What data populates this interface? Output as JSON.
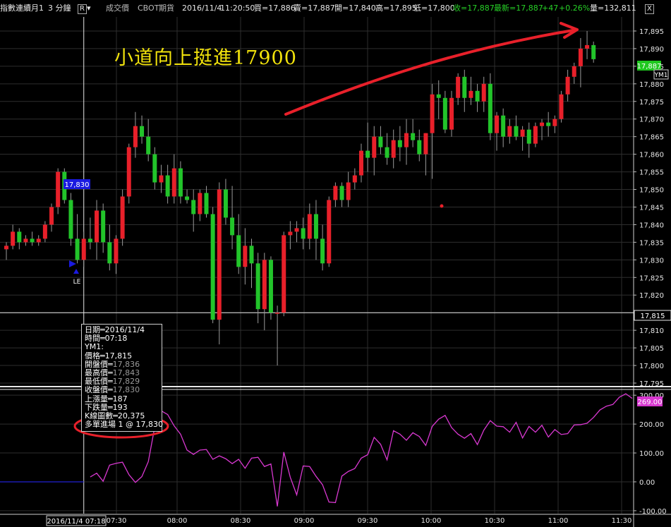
{
  "header": {
    "symbol": "指數連續月1",
    "interval": "3 分鐘",
    "r_button": "R",
    "price_type": "成交價",
    "exchange": "CBOT",
    "instrument": "期貨",
    "date": "2016/11/4",
    "time": "11:20:50",
    "bid": "買=17,886",
    "ask": "賣=17,887",
    "open": "開=17,840",
    "high": "高=17,895",
    "low": "低=17,800",
    "close": "收=17,887",
    "last": "最新=17,887",
    "change": "+47",
    "change_pct": "+0.26%",
    "volume": "量=132,811",
    "close_button": "X"
  },
  "annotation": {
    "title": "小道向上挺進17900",
    "entry_marker": "LE",
    "entry_price_tag": "17,830"
  },
  "info_box": {
    "date": "日期═2016/11/4",
    "time": "時間═07:18",
    "symbol": "YM1:",
    "price": "價格═17,815",
    "open_label": "開盤價═",
    "open_value": "17,836",
    "high_label": "最高價═",
    "high_value": "17,843",
    "low_label": "最低價═",
    "low_value": "17,829",
    "close_label": "收盤價═",
    "close_value": "17,830",
    "up_vol": "上漲量═187",
    "down_vol": "下跌量═193",
    "indicator": "K線圖數═20,375",
    "entry": "多單進場 1 @ 17,830"
  },
  "last_price_tag": "17,887",
  "symbol_tag": "YM1",
  "cursor_price_tag": "17,815",
  "indicator_tag": "269.00",
  "cursor_time_tag": "2016/11/4 07:18",
  "colors": {
    "up": "#e8202a",
    "down": "#22c42a",
    "indicator": "#d838d0",
    "background": "#000000",
    "grid": "#2e2e2e",
    "annotation_text": "#f2e30c",
    "arrow": "#e8202a",
    "last_price_tag": "#1fc81f",
    "indicator_tag": "#d838d0",
    "entry_tag": "#1a1ae0"
  },
  "chart_data": [
    {
      "type": "candlestick",
      "title": "",
      "x_ticks": [
        "07:30",
        "08:00",
        "08:30",
        "09:00",
        "09:30",
        "10:00",
        "10:30",
        "11:00",
        "11:30"
      ],
      "y_ticks": [
        17795,
        17800,
        17805,
        17810,
        17815,
        17820,
        17825,
        17830,
        17835,
        17840,
        17845,
        17850,
        17855,
        17860,
        17865,
        17870,
        17875,
        17880,
        17885,
        17890,
        17895
      ],
      "ylim": [
        17794,
        17899
      ],
      "grid": true,
      "candles": [
        {
          "o": 17833,
          "h": 17835,
          "l": 17830,
          "c": 17834
        },
        {
          "o": 17834,
          "h": 17840,
          "l": 17833,
          "c": 17838
        },
        {
          "o": 17838,
          "h": 17839,
          "l": 17833,
          "c": 17835
        },
        {
          "o": 17835,
          "h": 17837,
          "l": 17834,
          "c": 17836
        },
        {
          "o": 17836,
          "h": 17838,
          "l": 17834,
          "c": 17835
        },
        {
          "o": 17835,
          "h": 17837,
          "l": 17834,
          "c": 17836
        },
        {
          "o": 17836,
          "h": 17841,
          "l": 17835,
          "c": 17840
        },
        {
          "o": 17840,
          "h": 17846,
          "l": 17838,
          "c": 17845
        },
        {
          "o": 17845,
          "h": 17856,
          "l": 17843,
          "c": 17855
        },
        {
          "o": 17855,
          "h": 17856,
          "l": 17846,
          "c": 17847
        },
        {
          "o": 17847,
          "h": 17849,
          "l": 17834,
          "c": 17836
        },
        {
          "o": 17836,
          "h": 17843,
          "l": 17829,
          "c": 17830
        },
        {
          "o": 17830,
          "h": 17838,
          "l": 17828,
          "c": 17836
        },
        {
          "o": 17836,
          "h": 17842,
          "l": 17833,
          "c": 17835
        },
        {
          "o": 17835,
          "h": 17847,
          "l": 17830,
          "c": 17844
        },
        {
          "o": 17844,
          "h": 17846,
          "l": 17832,
          "c": 17835
        },
        {
          "o": 17835,
          "h": 17840,
          "l": 17827,
          "c": 17829
        },
        {
          "o": 17829,
          "h": 17837,
          "l": 17826,
          "c": 17836
        },
        {
          "o": 17836,
          "h": 17850,
          "l": 17834,
          "c": 17848
        },
        {
          "o": 17848,
          "h": 17863,
          "l": 17846,
          "c": 17862
        },
        {
          "o": 17862,
          "h": 17872,
          "l": 17859,
          "c": 17868
        },
        {
          "o": 17868,
          "h": 17871,
          "l": 17863,
          "c": 17865
        },
        {
          "o": 17865,
          "h": 17870,
          "l": 17858,
          "c": 17860
        },
        {
          "o": 17860,
          "h": 17862,
          "l": 17850,
          "c": 17852
        },
        {
          "o": 17852,
          "h": 17857,
          "l": 17849,
          "c": 17854
        },
        {
          "o": 17854,
          "h": 17857,
          "l": 17846,
          "c": 17848
        },
        {
          "o": 17848,
          "h": 17860,
          "l": 17846,
          "c": 17856
        },
        {
          "o": 17856,
          "h": 17858,
          "l": 17846,
          "c": 17848
        },
        {
          "o": 17848,
          "h": 17850,
          "l": 17846,
          "c": 17847
        },
        {
          "o": 17847,
          "h": 17850,
          "l": 17838,
          "c": 17843
        },
        {
          "o": 17843,
          "h": 17850,
          "l": 17841,
          "c": 17849
        },
        {
          "o": 17849,
          "h": 17851,
          "l": 17842,
          "c": 17843
        },
        {
          "o": 17843,
          "h": 17845,
          "l": 17812,
          "c": 17813
        },
        {
          "o": 17813,
          "h": 17852,
          "l": 17806,
          "c": 17850
        },
        {
          "o": 17850,
          "h": 17853,
          "l": 17840,
          "c": 17842
        },
        {
          "o": 17842,
          "h": 17851,
          "l": 17833,
          "c": 17837
        },
        {
          "o": 17837,
          "h": 17843,
          "l": 17826,
          "c": 17828
        },
        {
          "o": 17828,
          "h": 17839,
          "l": 17823,
          "c": 17834
        },
        {
          "o": 17834,
          "h": 17836,
          "l": 17822,
          "c": 17829
        },
        {
          "o": 17829,
          "h": 17832,
          "l": 17812,
          "c": 17816
        },
        {
          "o": 17816,
          "h": 17832,
          "l": 17810,
          "c": 17830
        },
        {
          "o": 17830,
          "h": 17831,
          "l": 17813,
          "c": 17815
        },
        {
          "o": 17815,
          "h": 17817,
          "l": 17800,
          "c": 17815
        },
        {
          "o": 17815,
          "h": 17838,
          "l": 17814,
          "c": 17837
        },
        {
          "o": 17837,
          "h": 17841,
          "l": 17833,
          "c": 17838
        },
        {
          "o": 17838,
          "h": 17841,
          "l": 17835,
          "c": 17839
        },
        {
          "o": 17839,
          "h": 17842,
          "l": 17833,
          "c": 17836
        },
        {
          "o": 17836,
          "h": 17846,
          "l": 17833,
          "c": 17843
        },
        {
          "o": 17843,
          "h": 17847,
          "l": 17830,
          "c": 17836
        },
        {
          "o": 17836,
          "h": 17840,
          "l": 17827,
          "c": 17829
        },
        {
          "o": 17829,
          "h": 17848,
          "l": 17828,
          "c": 17847
        },
        {
          "o": 17847,
          "h": 17852,
          "l": 17845,
          "c": 17851
        },
        {
          "o": 17851,
          "h": 17852,
          "l": 17845,
          "c": 17847
        },
        {
          "o": 17847,
          "h": 17855,
          "l": 17845,
          "c": 17852
        },
        {
          "o": 17852,
          "h": 17856,
          "l": 17850,
          "c": 17854
        },
        {
          "o": 17854,
          "h": 17863,
          "l": 17852,
          "c": 17861
        },
        {
          "o": 17861,
          "h": 17869,
          "l": 17855,
          "c": 17859
        },
        {
          "o": 17859,
          "h": 17868,
          "l": 17854,
          "c": 17865
        },
        {
          "o": 17865,
          "h": 17868,
          "l": 17860,
          "c": 17862
        },
        {
          "o": 17862,
          "h": 17866,
          "l": 17857,
          "c": 17859
        },
        {
          "o": 17859,
          "h": 17867,
          "l": 17856,
          "c": 17864
        },
        {
          "o": 17864,
          "h": 17868,
          "l": 17858,
          "c": 17862
        },
        {
          "o": 17862,
          "h": 17870,
          "l": 17857,
          "c": 17866
        },
        {
          "o": 17866,
          "h": 17870,
          "l": 17862,
          "c": 17864
        },
        {
          "o": 17864,
          "h": 17867,
          "l": 17858,
          "c": 17860
        },
        {
          "o": 17860,
          "h": 17866,
          "l": 17854,
          "c": 17866
        },
        {
          "o": 17866,
          "h": 17880,
          "l": 17853,
          "c": 17877
        },
        {
          "o": 17877,
          "h": 17881,
          "l": 17870,
          "c": 17876
        },
        {
          "o": 17876,
          "h": 17878,
          "l": 17866,
          "c": 17867
        },
        {
          "o": 17867,
          "h": 17878,
          "l": 17865,
          "c": 17876
        },
        {
          "o": 17876,
          "h": 17883,
          "l": 17874,
          "c": 17882
        },
        {
          "o": 17882,
          "h": 17884,
          "l": 17872,
          "c": 17876
        },
        {
          "o": 17876,
          "h": 17882,
          "l": 17874,
          "c": 17878
        },
        {
          "o": 17878,
          "h": 17880,
          "l": 17872,
          "c": 17875
        },
        {
          "o": 17875,
          "h": 17882,
          "l": 17872,
          "c": 17880
        },
        {
          "o": 17880,
          "h": 17883,
          "l": 17864,
          "c": 17866
        },
        {
          "o": 17866,
          "h": 17872,
          "l": 17861,
          "c": 17871
        },
        {
          "o": 17871,
          "h": 17873,
          "l": 17862,
          "c": 17865
        },
        {
          "o": 17865,
          "h": 17870,
          "l": 17863,
          "c": 17868
        },
        {
          "o": 17868,
          "h": 17871,
          "l": 17864,
          "c": 17865
        },
        {
          "o": 17865,
          "h": 17868,
          "l": 17861,
          "c": 17867
        },
        {
          "o": 17867,
          "h": 17869,
          "l": 17859,
          "c": 17863
        },
        {
          "o": 17863,
          "h": 17869,
          "l": 17862,
          "c": 17868
        },
        {
          "o": 17868,
          "h": 17870,
          "l": 17864,
          "c": 17869
        },
        {
          "o": 17869,
          "h": 17872,
          "l": 17865,
          "c": 17868
        },
        {
          "o": 17868,
          "h": 17871,
          "l": 17866,
          "c": 17870
        },
        {
          "o": 17870,
          "h": 17878,
          "l": 17869,
          "c": 17877
        },
        {
          "o": 17877,
          "h": 17884,
          "l": 17875,
          "c": 17882
        },
        {
          "o": 17882,
          "h": 17886,
          "l": 17880,
          "c": 17885
        },
        {
          "o": 17885,
          "h": 17893,
          "l": 17879,
          "c": 17890
        },
        {
          "o": 17890,
          "h": 17895,
          "l": 17887,
          "c": 17891
        },
        {
          "o": 17891,
          "h": 17892,
          "l": 17886,
          "c": 17887
        }
      ]
    },
    {
      "type": "line",
      "y_ticks": [
        -100,
        0,
        100,
        200,
        300
      ],
      "ylim": [
        -110,
        320
      ],
      "series": [
        {
          "values": [
            17,
            30,
            2,
            58,
            64,
            68,
            25,
            -2,
            18,
            70,
            190,
            246,
            233,
            194,
            165,
            110,
            95,
            110,
            112,
            78,
            90,
            80,
            63,
            78,
            47,
            82,
            85,
            53,
            62,
            -85,
            103,
            16,
            -45,
            55,
            53,
            19,
            -10,
            -70,
            -72,
            20,
            36,
            46,
            82,
            94,
            154,
            130,
            76,
            177,
            165,
            144,
            170,
            157,
            126,
            192,
            217,
            230,
            188,
            165,
            151,
            167,
            129,
            179,
            212,
            193,
            191,
            172,
            206,
            152,
            192,
            172,
            196,
            155,
            181,
            164,
            167,
            197,
            198,
            203,
            223,
            249,
            262,
            268,
            293,
            305,
            289
          ]
        }
      ]
    }
  ]
}
